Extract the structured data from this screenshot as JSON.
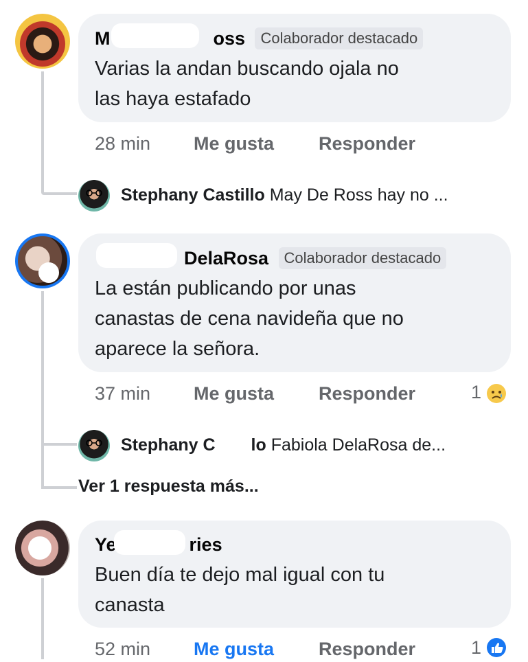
{
  "comments": [
    {
      "name_left": "M",
      "name_right": "oss",
      "badge": "Colaborador destacado",
      "text_line1": "Varias la andan buscando ojala no",
      "text_line2": "las haya estafado",
      "time": "28 min",
      "like": "Me gusta",
      "reply": "Responder"
    },
    {
      "name_left": "",
      "name_right": "DelaRosa",
      "badge": "Colaborador destacado",
      "text_line1": "La están publicando por unas",
      "text_line2": "canastas de cena navideña que no",
      "text_line3": "aparece la señora.",
      "time": "37 min",
      "like": "Me gusta",
      "reply": "Responder",
      "reaction_count": "1",
      "reaction_icon": "sad-emoji-icon"
    },
    {
      "name_left": "Ye",
      "name_right": "ries",
      "text_line1": "Buen día te dejo mal igual con tu",
      "text_line2": "canasta",
      "time": "52 min",
      "like": "Me gusta",
      "reply": "Responder",
      "reaction_count": "1",
      "reaction_icon": "like-thumb-icon"
    }
  ],
  "replies": [
    {
      "author": "Stephany Castillo",
      "preview": "May De Ross hay no ..."
    },
    {
      "author_left": "Stephany C",
      "author_right": "lo",
      "preview": "Fabiola DelaRosa de..."
    }
  ],
  "more_replies": "Ver 1 respuesta más...",
  "colors": {
    "bubble": "#f0f2f5",
    "meta_text": "#65676b",
    "like_active": "#1877f2",
    "thread_line": "#ced0d4"
  }
}
